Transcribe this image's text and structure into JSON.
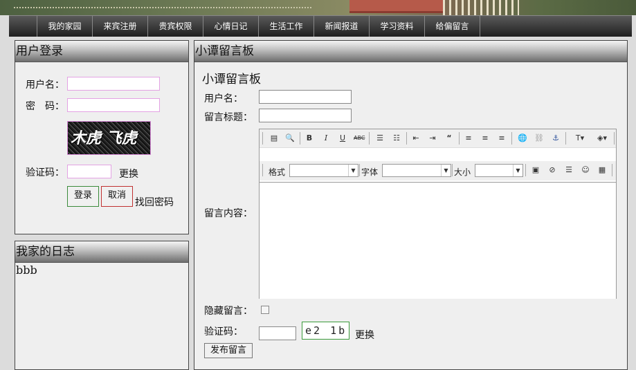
{
  "nav": {
    "items": [
      "我的家园",
      "来宾注册",
      "贵宾权限",
      "心情日记",
      "生活工作",
      "新闻报道",
      "学习资料",
      "给偏留言"
    ]
  },
  "login": {
    "title": "用户登录",
    "username_label": "用户名：",
    "password_label": "密　码：",
    "captcha_image_text": "木虎 飞虎",
    "captcha_label": "验证码：",
    "refresh_label": "更换",
    "login_button": "登录",
    "cancel_button": "取消",
    "forgot_link": "找回密码"
  },
  "diary": {
    "title": "我家的日志",
    "content": "bbb"
  },
  "guestbook": {
    "title": "小谭留言板",
    "subtitle": "小谭留言板",
    "username_label": "用户名：",
    "subject_label": "留言标题：",
    "content_label": "留言内容：",
    "hidden_label": "隐藏留言：",
    "captcha_label": "验证码：",
    "captcha_text": "e2 1b",
    "refresh_label": "更换",
    "submit_button": "发布留言",
    "editor": {
      "format_label": "格式",
      "font_label": "字体",
      "size_label": "大小"
    }
  },
  "colors": {
    "nav_bg": "#2b2b2b",
    "input_focus_border": "#e3a2e3",
    "login_button_border": "#3a8a3a",
    "cancel_button_border": "#c03030"
  }
}
